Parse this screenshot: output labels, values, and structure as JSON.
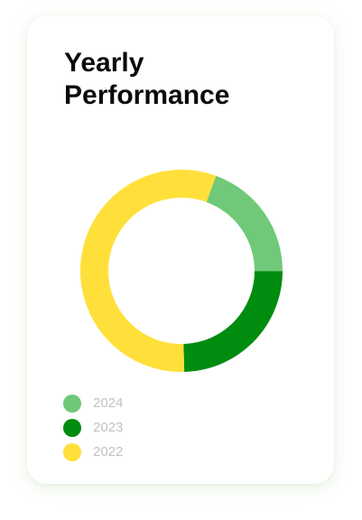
{
  "chart_data": {
    "type": "pie",
    "variant": "donut",
    "title": "Yearly Performance",
    "title_lines": [
      "Yearly",
      "Performance"
    ],
    "start_angle_deg": 20,
    "direction": "clockwise",
    "legend_position": "bottom-left",
    "slices": [
      {
        "label": "2024",
        "value": 19.5,
        "color": "#6fc978"
      },
      {
        "label": "2023",
        "value": 24.5,
        "color": "#008c0f"
      },
      {
        "label": "2022",
        "value": 56.0,
        "color": "#ffe03a"
      }
    ]
  }
}
